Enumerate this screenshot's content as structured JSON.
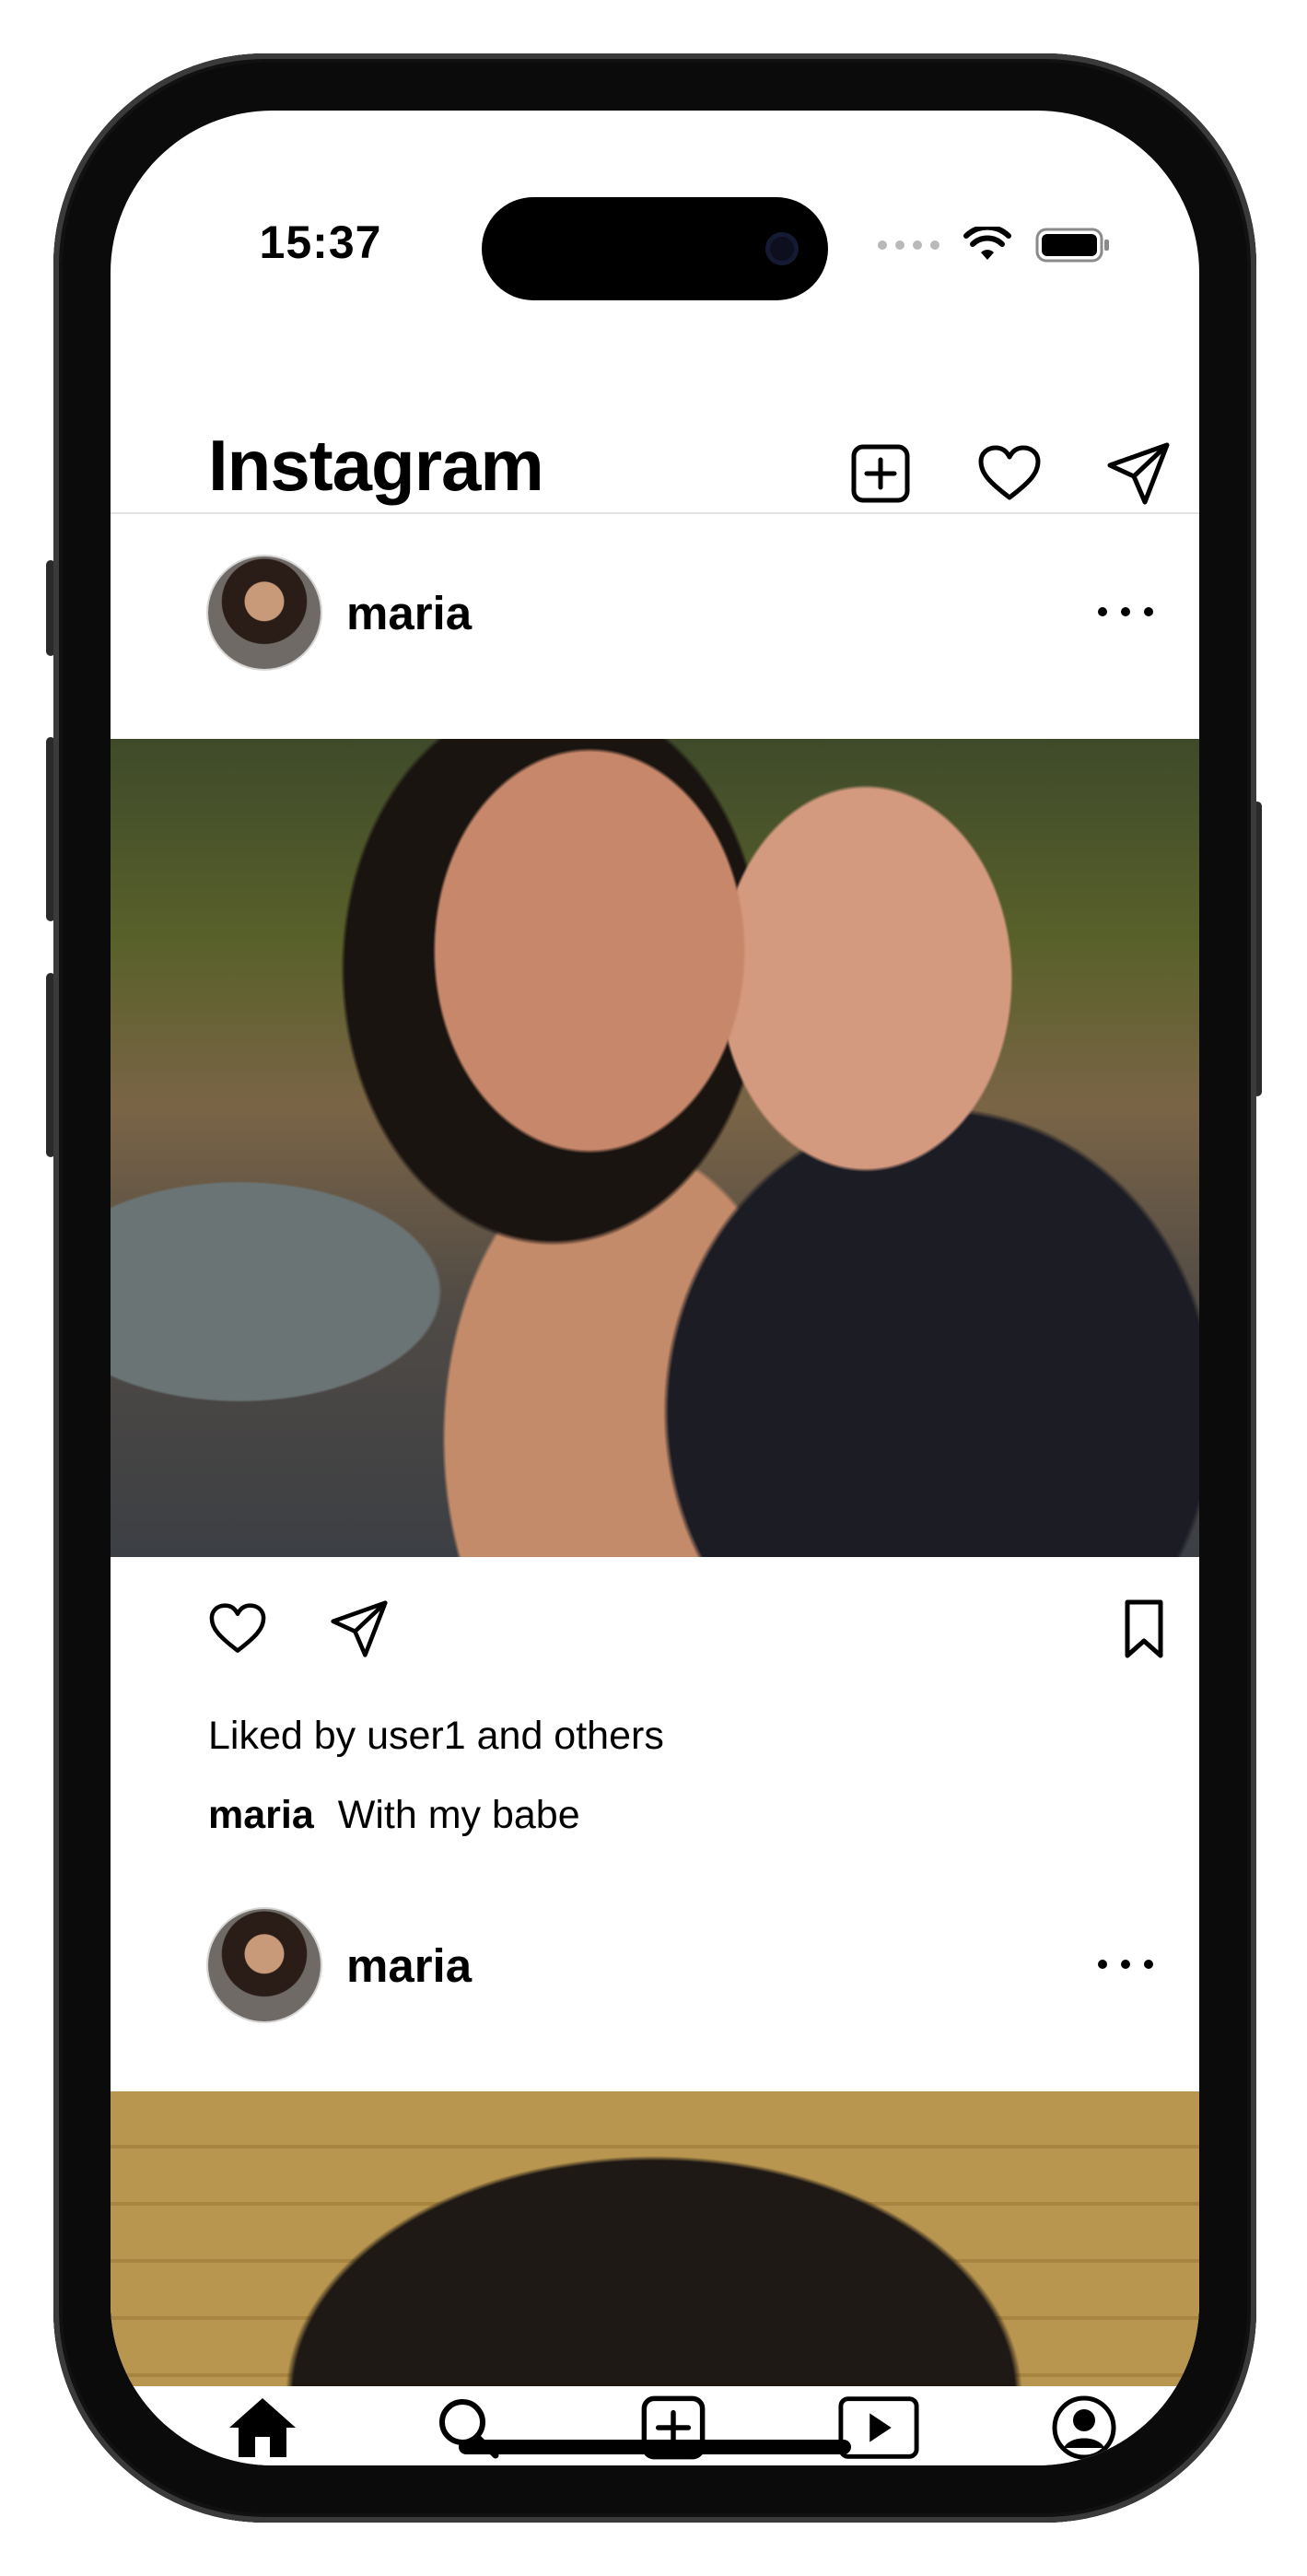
{
  "status_bar": {
    "time": "15:37",
    "icons": [
      "cellular-dots-icon",
      "wifi-icon",
      "battery-icon"
    ]
  },
  "header": {
    "title": "Instagram",
    "icons": [
      "add-post-icon",
      "heart-icon",
      "send-icon"
    ]
  },
  "feed": {
    "posts": [
      {
        "username": "maria",
        "photo": "selfie of a couple at night on a street",
        "liked_text": "Liked by user1 and others",
        "caption_user": "maria",
        "caption_text": "With my babe"
      },
      {
        "username": "maria",
        "photo": "close-up of dark hair against wooden ceiling"
      }
    ]
  },
  "tab_bar": {
    "tabs": [
      "home-icon",
      "search-icon",
      "add-post-icon",
      "reels-icon",
      "profile-icon"
    ]
  },
  "colors": {
    "background": "#ffffff",
    "text": "#000000",
    "divider": "#e3e3e3"
  }
}
